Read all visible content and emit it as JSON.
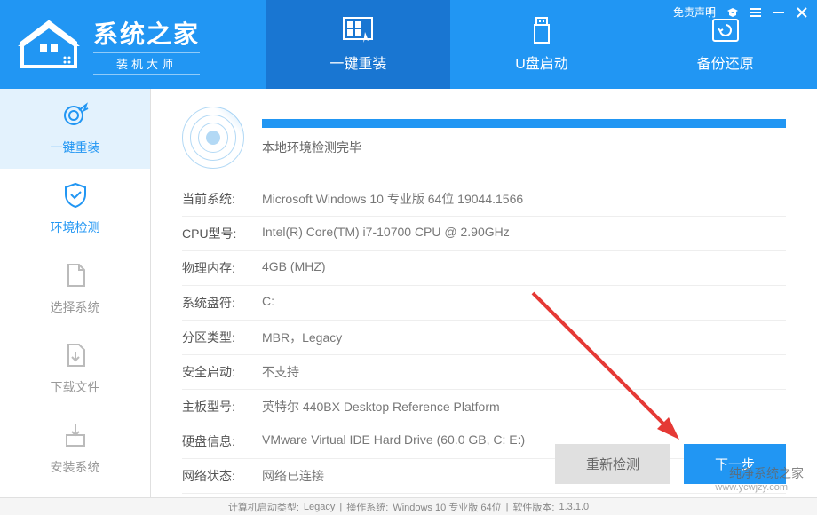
{
  "window_controls": {
    "disclaimer": "免责声明"
  },
  "header": {
    "brand_title": "系统之家",
    "brand_subtitle": "装机大师",
    "tabs": [
      {
        "label": "一键重装"
      },
      {
        "label": "U盘启动"
      },
      {
        "label": "备份还原"
      }
    ]
  },
  "sidebar": {
    "items": [
      {
        "label": "一键重装"
      },
      {
        "label": "环境检测"
      },
      {
        "label": "选择系统"
      },
      {
        "label": "下载文件"
      },
      {
        "label": "安装系统"
      }
    ]
  },
  "content": {
    "scan_status": "本地环境检测完毕",
    "info_rows": [
      {
        "label": "当前系统:",
        "value": "Microsoft Windows 10 专业版 64位 19044.1566"
      },
      {
        "label": "CPU型号:",
        "value": "Intel(R) Core(TM) i7-10700 CPU @ 2.90GHz"
      },
      {
        "label": "物理内存:",
        "value": "4GB (MHZ)"
      },
      {
        "label": "系统盘符:",
        "value": "C:"
      },
      {
        "label": "分区类型:",
        "value": "MBR，Legacy"
      },
      {
        "label": "安全启动:",
        "value": "不支持"
      },
      {
        "label": "主板型号:",
        "value": "英特尔 440BX Desktop Reference Platform"
      },
      {
        "label": "硬盘信息:",
        "value": "VMware Virtual IDE Hard Drive  (60.0 GB, C: E:)"
      },
      {
        "label": "网络状态:",
        "value": "网络已连接"
      }
    ],
    "buttons": {
      "recheck": "重新检测",
      "next": "下一步"
    }
  },
  "footer": {
    "boot_type_label": "计算机启动类型:",
    "boot_type_value": "Legacy",
    "os_label": "操作系统:",
    "os_value": "Windows 10 专业版 64位",
    "sw_label": "软件版本:",
    "sw_value": "1.3.1.0"
  },
  "watermark": {
    "line1": "纯净系统之家",
    "line2": "www.ycwjzy.com"
  }
}
